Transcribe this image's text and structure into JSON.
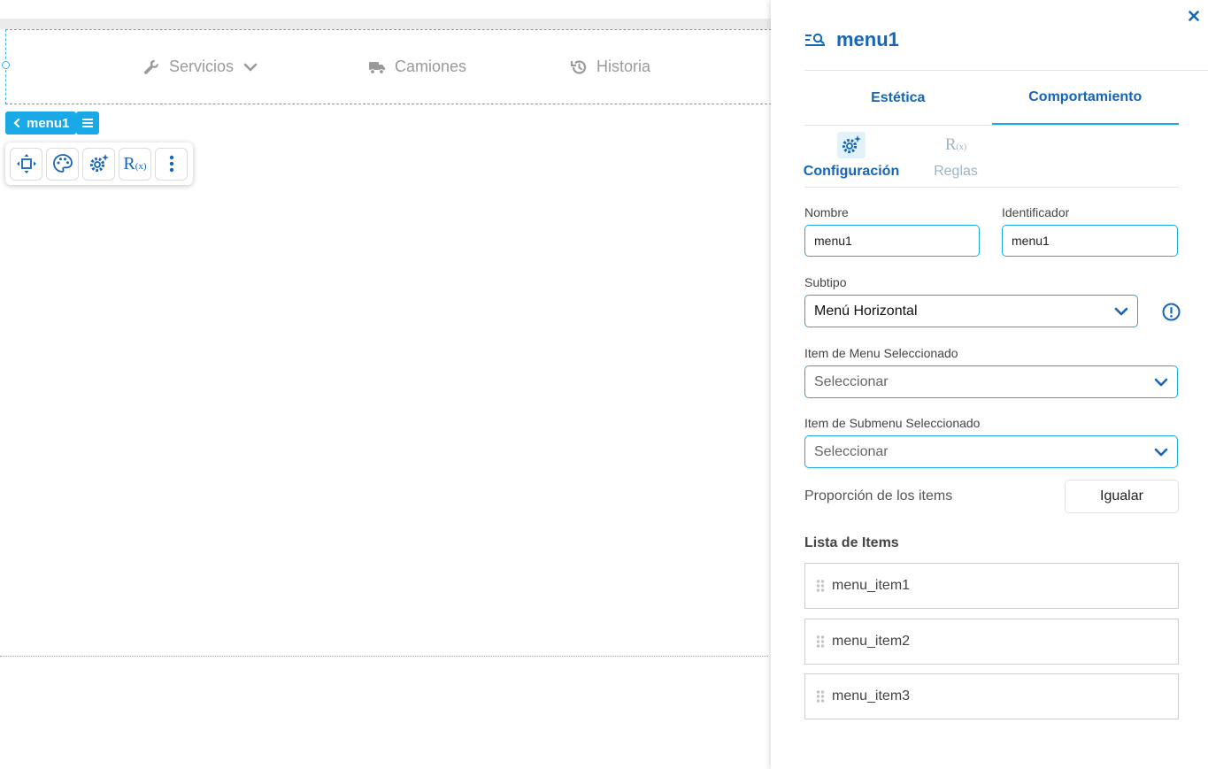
{
  "canvas": {
    "menu_items": [
      {
        "label": "Servicios",
        "icon": "wrench-icon",
        "has_dropdown": true
      },
      {
        "label": "Camiones",
        "icon": "truck-icon",
        "has_dropdown": false
      },
      {
        "label": "Historia",
        "icon": "history-icon",
        "has_dropdown": false
      }
    ],
    "selected_tag": "menu1",
    "toolbar": [
      "move-icon",
      "palette-icon",
      "settings-gear-icon",
      "rules-fx-icon",
      "more-vertical-icon"
    ],
    "toolbar_rules_label": "R",
    "toolbar_rules_sub": "(x)"
  },
  "panel": {
    "title": "menu1",
    "tabs": [
      {
        "label": "Estética",
        "active": false
      },
      {
        "label": "Comportamiento",
        "active": true
      }
    ],
    "subtabs": [
      {
        "label": "Configuración",
        "active": true
      },
      {
        "label": "Reglas",
        "active": false
      }
    ],
    "rules_glyph": "R",
    "rules_glyph_sub": "(x)",
    "form": {
      "nombre_label": "Nombre",
      "nombre_value": "menu1",
      "identificador_label": "Identificador",
      "identificador_value": "menu1",
      "subtipo_label": "Subtipo",
      "subtipo_value": "Menú Horizontal",
      "item_menu_label": "Item de Menu Seleccionado",
      "item_menu_value": "Seleccionar",
      "item_submenu_label": "Item de Submenu Seleccionado",
      "item_submenu_value": "Seleccionar",
      "proporcion_label": "Proporción de los items",
      "igualar_label": "Igualar"
    },
    "list_title": "Lista de Items",
    "items": [
      "menu_item1",
      "menu_item2",
      "menu_item3"
    ]
  },
  "colors": {
    "accent": "#18a9e6",
    "primary_text": "#1565b8",
    "muted_text": "#9a9a9a"
  }
}
